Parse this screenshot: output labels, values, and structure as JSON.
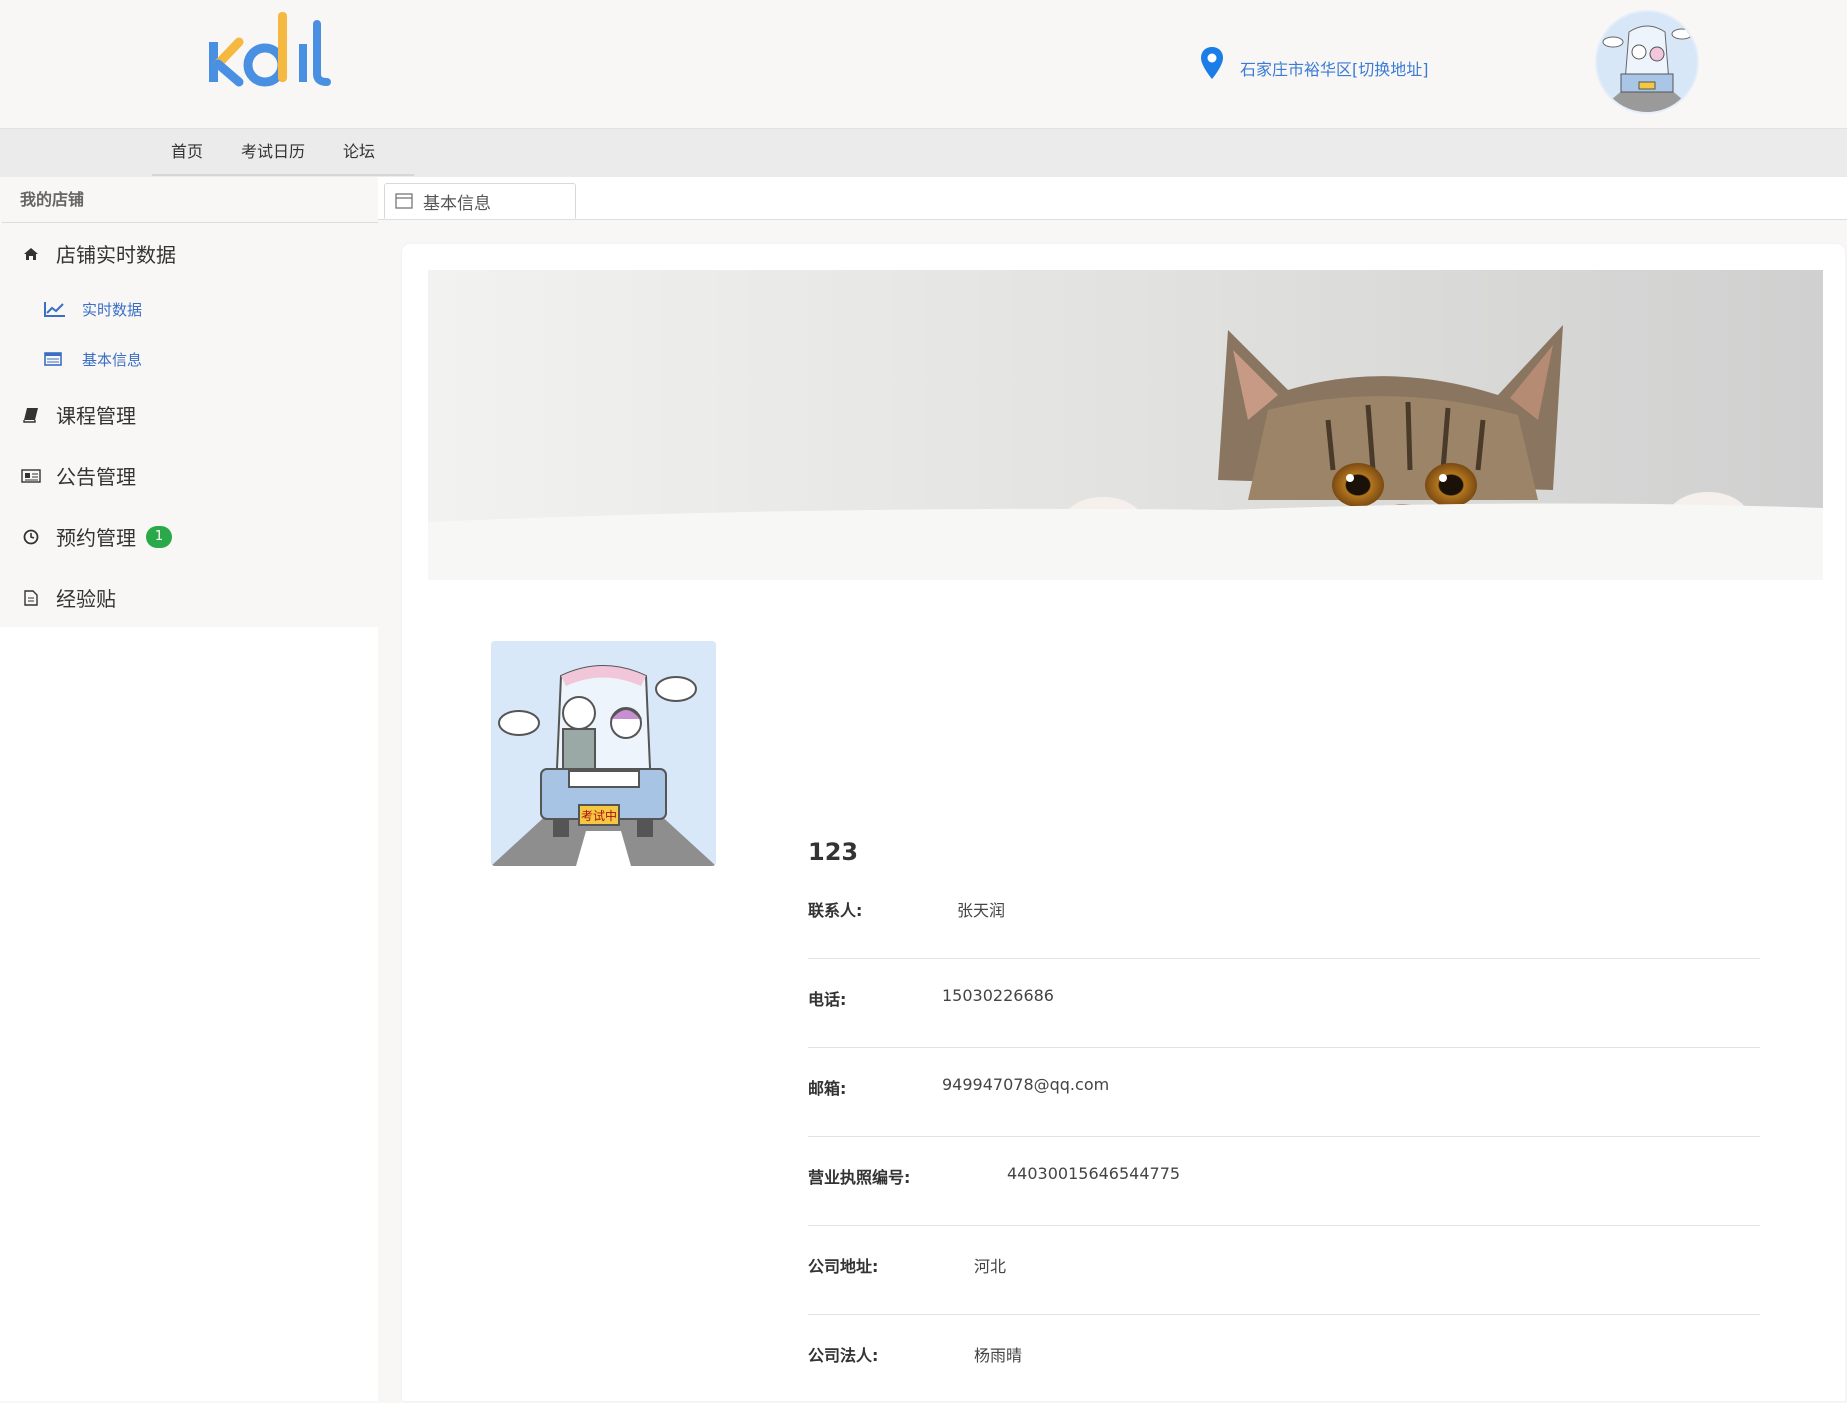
{
  "header": {
    "logo_text": "kdil",
    "location": "石家庄市裕华区[切换地址]"
  },
  "nav": {
    "items": [
      {
        "label": "首页"
      },
      {
        "label": "考试日历"
      },
      {
        "label": "论坛"
      }
    ]
  },
  "sidebar": {
    "title": "我的店铺",
    "items": [
      {
        "label": "店铺实时数据",
        "icon": "home-icon"
      },
      {
        "label": "实时数据",
        "icon": "line-chart-icon",
        "sub": true
      },
      {
        "label": "基本信息",
        "icon": "table-icon",
        "sub": true
      },
      {
        "label": "课程管理",
        "icon": "book-icon"
      },
      {
        "label": "公告管理",
        "icon": "newspaper-icon"
      },
      {
        "label": "预约管理",
        "icon": "clock-icon",
        "badge": "1"
      },
      {
        "label": "经验贴",
        "icon": "file-icon"
      }
    ]
  },
  "tabs": [
    {
      "label": "基本信息",
      "icon": "window-icon"
    }
  ],
  "shop": {
    "name": "123",
    "avatar_caption": "考试中",
    "fields": [
      {
        "label": "联系人:",
        "value": "张天润"
      },
      {
        "label": "电话:",
        "value": "15030226686"
      },
      {
        "label": "邮箱:",
        "value": "949947078@qq.com"
      },
      {
        "label": "营业执照编号:",
        "value": "44030015646544775"
      },
      {
        "label": "公司地址:",
        "value": "河北"
      },
      {
        "label": "公司法人:",
        "value": "杨雨晴"
      }
    ]
  },
  "colors": {
    "link": "#3a7bd5",
    "badge": "#2aa94a",
    "logo_blue": "#4a90e2",
    "logo_yellow": "#f5b841"
  }
}
